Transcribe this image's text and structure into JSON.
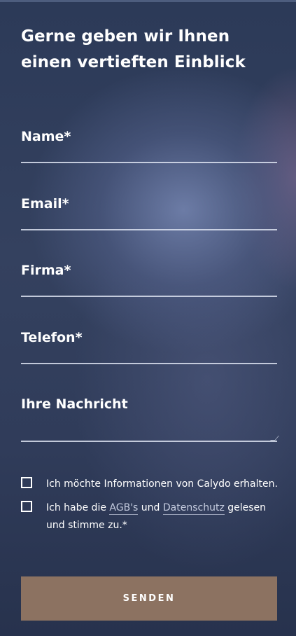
{
  "form": {
    "heading": "Gerne geben wir Ihnen einen vertieften Einblick",
    "fields": {
      "name": {
        "label": "Name*",
        "value": ""
      },
      "email": {
        "label": "Email*",
        "value": ""
      },
      "firma": {
        "label": "Firma*",
        "value": ""
      },
      "telefon": {
        "label": "Telefon*",
        "value": ""
      },
      "nachricht": {
        "label": "Ihre Nachricht",
        "value": ""
      }
    },
    "checkboxes": {
      "newsletter": {
        "text": "Ich möchte Informationen von Calydo erhalten.",
        "checked": false
      },
      "terms": {
        "text_before": "Ich habe die ",
        "agb_link": "AGB's",
        "text_mid": " und ",
        "privacy_link": "Datenschutz",
        "text_after": " gelesen und stimme zu.*",
        "checked": false
      }
    },
    "submit_label": "SENDEN"
  },
  "colors": {
    "background": "#2f3d5a",
    "button": "#8c7261",
    "text": "#ffffff",
    "link": "#c6cde0"
  }
}
